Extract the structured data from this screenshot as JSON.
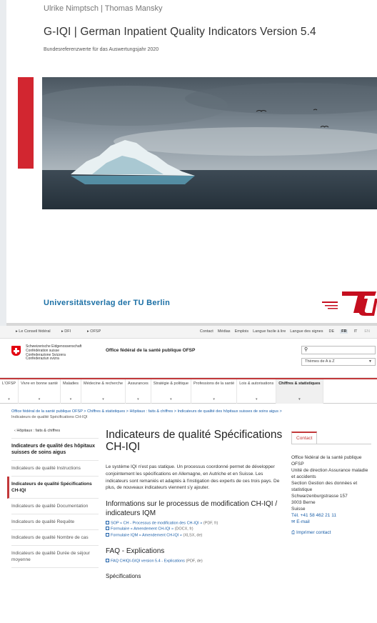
{
  "cover": {
    "authors": "Ulrike Nimptsch | Thomas Mansky",
    "title": "G-IQI | German Inpatient Quality Indicators Version 5.4",
    "subtitle": "Bundesreferenzwerte für das Auswertungsjahr 2020",
    "publisher": "Universitätsverlag der TU Berlin",
    "accent_color": "#d22630",
    "publisher_color": "#1a6fa5"
  },
  "topnav": {
    "crumbs": [
      "Le Conseil fédéral",
      "DFI",
      "OFSP"
    ],
    "links": [
      "Contact",
      "Médias",
      "Emplois",
      "Langue facile à lire",
      "Langue des signes"
    ],
    "languages": [
      "DE",
      "FR",
      "IT",
      "EN"
    ],
    "active_language": "FR"
  },
  "header": {
    "confederation": [
      "Schweizerische Eidgenossenschaft",
      "Confédération suisse",
      "Confederazione Svizzera",
      "Confederaziun svizra"
    ],
    "department": "Office fédéral de la santé publique OFSP",
    "search_icon": "search-icon",
    "az_label": "Thèmes de A à Z"
  },
  "mainnav": {
    "items": [
      "L'OFSP",
      "Vivre en bonne santé",
      "Maladies",
      "Médecine & recherche",
      "Assurances",
      "Stratégie & politique",
      "Professions de la santé",
      "Lois & autorisations",
      "Chiffres & statistiques"
    ],
    "active": "Chiffres & statistiques",
    "accent_color": "#c2383a"
  },
  "breadcrumbs": {
    "items": [
      "Office fédéral de la santé publique OFSP",
      "Chiffres & statistiques",
      "Hôpitaux : faits & chiffres",
      "Indicateurs de qualité des hôpitaux suisses de soins aigus"
    ],
    "current": "Indicateurs de qualité Spécifications CH-IQI"
  },
  "sidebar": {
    "back": "Hôpitaux : faits & chiffres",
    "heading": "Indicateurs de qualité des hôpitaux suisses de soins aigus",
    "links": [
      "Indicateurs de qualité Instructions",
      "Indicateurs de qualité Spécifications CH-IQI",
      "Indicateurs de qualité Documentation",
      "Indicateurs de qualité Requête",
      "Indicateurs de qualité Nombre de cas",
      "Indicateurs de qualité Durée de séjour moyenne"
    ],
    "active_index": 1
  },
  "main": {
    "title": "Indicateurs de qualité Spécifications CH-IQI",
    "intro": "Le système IQI n'est pas statique. Un processus coordonné permet de développer conjointement les spécifications en Allemagne, en Autriche et en Suisse. Les indicateurs sont remaniés et adaptés à l'instigation des experts de ces trois pays. De plus, de nouveaux indicateurs viennent s'y ajouter.",
    "section1_title": "Informations sur le processus de modification CH-IQI / indicateurs IQM",
    "section1_files": [
      {
        "label": "SOP « CH - Processus de modification des CH-IQI »",
        "meta": "(PDF, fr)"
      },
      {
        "label": "Formulaire « Amendement CH-IQI »",
        "meta": "(DOCX, fr)"
      },
      {
        "label": "Formulaire IQM « Amendement CH-IQI »",
        "meta": "(XLSX, de)"
      }
    ],
    "section2_title": "FAQ - Explications",
    "section2_files": [
      {
        "label": "FAQ CHIQI-GIQI version 5.4 - Explications",
        "meta": "(PDF, de)"
      }
    ],
    "section3_title": "Spécifications"
  },
  "contact": {
    "tab": "Contact",
    "lines": [
      "Office fédéral de la santé publique OFSP",
      "Unité de direction Assurance maladie et accidents",
      "Section Gestion des données et statistique",
      "Schwarzenburgstrasse 157",
      "3003 Berne",
      "Suisse"
    ],
    "phone": "Tél. +41 58 462 21 11",
    "email": "E-mail",
    "print": "Imprimer contact"
  }
}
